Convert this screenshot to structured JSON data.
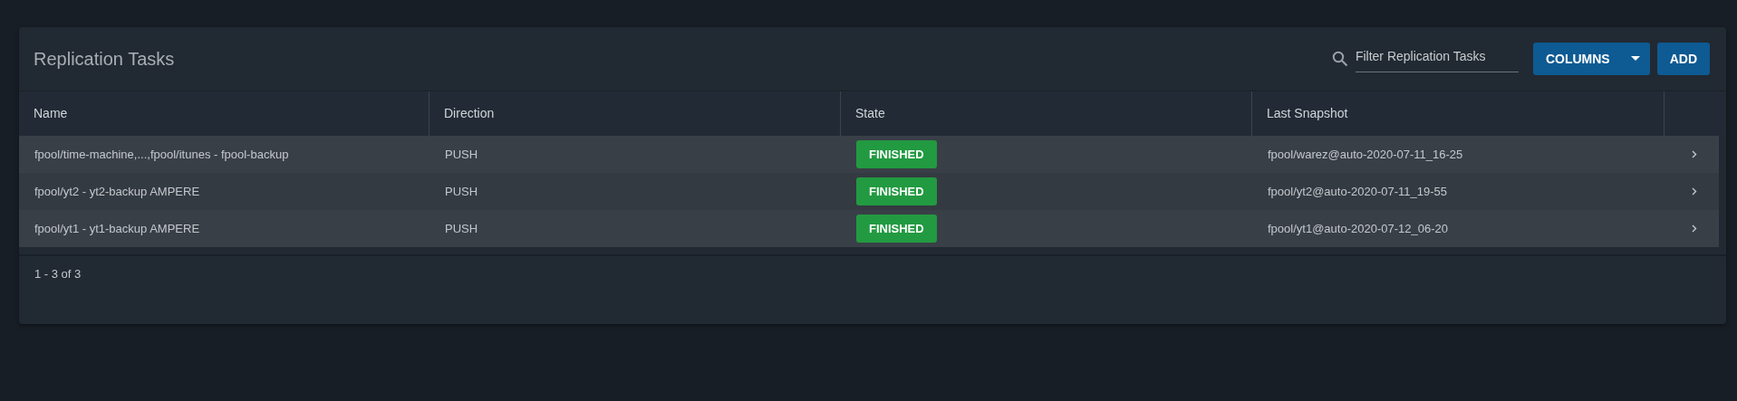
{
  "card": {
    "title": "Replication Tasks",
    "filter": {
      "placeholder": "Filter Replication Tasks"
    },
    "buttons": [
      {
        "label": "COLUMNS",
        "kind": "dropdown"
      },
      {
        "label": "ADD",
        "kind": "plain"
      }
    ]
  },
  "table": {
    "columns": [
      "Name",
      "Direction",
      "State",
      "Last Snapshot"
    ],
    "rows": [
      {
        "name": "fpool/time-machine,...,fpool/itunes - fpool-backup",
        "direction": "PUSH",
        "state": "FINISHED",
        "last_snapshot": "fpool/warez@auto-2020-07-11_16-25"
      },
      {
        "name": "fpool/yt2 - yt2-backup AMPERE",
        "direction": "PUSH",
        "state": "FINISHED",
        "last_snapshot": "fpool/yt2@auto-2020-07-11_19-55"
      },
      {
        "name": "fpool/yt1 - yt1-backup AMPERE",
        "direction": "PUSH",
        "state": "FINISHED",
        "last_snapshot": "fpool/yt1@auto-2020-07-12_06-20"
      }
    ]
  },
  "paginator": {
    "range": "1 - 3 of 3"
  }
}
